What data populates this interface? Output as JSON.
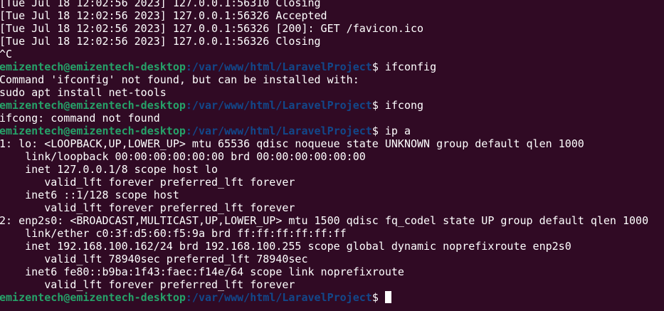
{
  "colors": {
    "background": "#300a24",
    "foreground": "#ffffff",
    "prompt_user": "#26a269",
    "prompt_path": "#12488b"
  },
  "prompt": {
    "user_host": "emizentech@emizentech-desktop",
    "path": ":/var/www/html/LaravelProject",
    "symbol": "$"
  },
  "output": {
    "log1": "[Tue Jul 18 12:02:56 2023] 127.0.0.1:56310 Closing",
    "log2": "[Tue Jul 18 12:02:56 2023] 127.0.0.1:56326 Accepted",
    "log3": "[Tue Jul 18 12:02:56 2023] 127.0.0.1:56326 [200]: GET /favicon.ico",
    "log4": "[Tue Jul 18 12:02:56 2023] 127.0.0.1:56326 Closing",
    "interrupt": "^C",
    "cmd1": " ifconfig",
    "err1a": "Command 'ifconfig' not found, but can be installed with:",
    "err1b": "sudo apt install net-tools",
    "cmd2": " ifcong",
    "err2": "ifcong: command not found",
    "cmd3": " ip a",
    "ip1": "1: lo: <LOOPBACK,UP,LOWER_UP> mtu 65536 qdisc noqueue state UNKNOWN group default qlen 1000",
    "ip2": "    link/loopback 00:00:00:00:00:00 brd 00:00:00:00:00:00",
    "ip3": "    inet 127.0.0.1/8 scope host lo",
    "ip4": "       valid_lft forever preferred_lft forever",
    "ip5": "    inet6 ::1/128 scope host",
    "ip6": "       valid_lft forever preferred_lft forever",
    "ip7": "2: enp2s0: <BROADCAST,MULTICAST,UP,LOWER_UP> mtu 1500 qdisc fq_codel state UP group default qlen 1000",
    "ip8": "    link/ether c0:3f:d5:60:f5:9a brd ff:ff:ff:ff:ff:ff",
    "ip9": "    inet 192.168.100.162/24 brd 192.168.100.255 scope global dynamic noprefixroute enp2s0",
    "ip10": "       valid_lft 78940sec preferred_lft 78940sec",
    "ip11": "    inet6 fe80::b9ba:1f43:faec:f14e/64 scope link noprefixroute",
    "ip12": "       valid_lft forever preferred_lft forever"
  }
}
